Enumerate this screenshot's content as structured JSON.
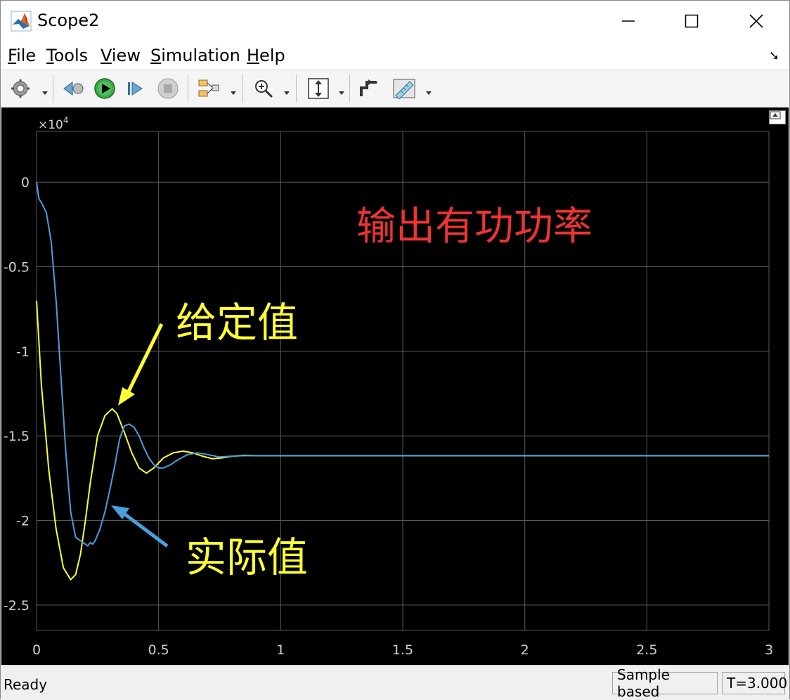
{
  "window": {
    "title": "Scope2"
  },
  "menu": {
    "file_prefix": "",
    "file_ul": "F",
    "file_rest": "ile",
    "tools_ul": "T",
    "tools_rest": "ools",
    "view_ul": "V",
    "view_rest": "iew",
    "simulation_pre": "",
    "simulation_ul": "S",
    "simulation_rest": "imulation",
    "help_ul": "H",
    "help_rest": "elp"
  },
  "toolbar": {
    "icons": [
      "gear-icon",
      "step-back-icon",
      "run-icon",
      "step-forward-icon",
      "stop-icon",
      "signal-selector-icon",
      "zoom-in-icon",
      "scale-axes-icon",
      "cursor-measure-icon",
      "ruler-icon"
    ]
  },
  "status": {
    "ready": "Ready",
    "sample_mode": "Sample based",
    "time": "T=3.000"
  },
  "colors": {
    "plot_bg": "#000000",
    "grid": "#5a5a5a",
    "tick_text": "#d0d0d0",
    "series_given": "#ffff33",
    "series_actual": "#4a9fde",
    "annotation_title": "#ee3333",
    "annotation_label": "#ffff33",
    "arrow_given": "#ffff33",
    "arrow_actual": "#4a9fde"
  },
  "chart_data": {
    "type": "line",
    "title": "",
    "xlabel": "",
    "ylabel": "",
    "y_multiplier": "×10",
    "y_multiplier_exp": "4",
    "xlim": [
      0,
      3
    ],
    "ylim": [
      -2.65,
      0.3
    ],
    "xticks": [
      "0",
      "0.5",
      "1",
      "1.5",
      "2",
      "2.5",
      "3"
    ],
    "xtick_values": [
      0,
      0.5,
      1,
      1.5,
      2,
      2.5,
      3
    ],
    "yticks": [
      "0",
      "-0.5",
      "-1",
      "-1.5",
      "-2",
      "-2.5"
    ],
    "ytick_values": [
      0,
      -0.5,
      -1,
      -1.5,
      -2,
      -2.5
    ],
    "grid": true,
    "series": [
      {
        "key": "given",
        "x": [
          0,
          0.02,
          0.05,
          0.08,
          0.11,
          0.14,
          0.16,
          0.18,
          0.2,
          0.22,
          0.25,
          0.28,
          0.31,
          0.33,
          0.36,
          0.39,
          0.42,
          0.45,
          0.48,
          0.52,
          0.56,
          0.6,
          0.64,
          0.68,
          0.72,
          0.76,
          0.8,
          0.85,
          0.9,
          1,
          1.5,
          2,
          2.5,
          3
        ],
        "y": [
          -0.7,
          -1.2,
          -1.7,
          -2.05,
          -2.28,
          -2.35,
          -2.32,
          -2.2,
          -2.0,
          -1.78,
          -1.5,
          -1.38,
          -1.34,
          -1.37,
          -1.48,
          -1.6,
          -1.69,
          -1.72,
          -1.69,
          -1.63,
          -1.6,
          -1.59,
          -1.6,
          -1.62,
          -1.635,
          -1.63,
          -1.62,
          -1.615,
          -1.617,
          -1.617,
          -1.617,
          -1.617,
          -1.617,
          -1.617
        ]
      },
      {
        "key": "actual",
        "x": [
          0,
          0.005,
          0.01,
          0.02,
          0.04,
          0.06,
          0.08,
          0.1,
          0.12,
          0.14,
          0.16,
          0.18,
          0.2,
          0.21,
          0.22,
          0.23,
          0.24,
          0.26,
          0.28,
          0.3,
          0.32,
          0.34,
          0.36,
          0.38,
          0.4,
          0.42,
          0.44,
          0.46,
          0.48,
          0.5,
          0.52,
          0.55,
          0.58,
          0.62,
          0.66,
          0.7,
          0.75,
          0.8,
          0.85,
          0.9,
          1,
          1.5,
          2,
          2.5,
          3
        ],
        "y": [
          0,
          -0.05,
          -0.1,
          -0.12,
          -0.18,
          -0.35,
          -0.7,
          -1.15,
          -1.6,
          -1.95,
          -2.1,
          -2.12,
          -2.14,
          -2.15,
          -2.13,
          -2.14,
          -2.12,
          -2.05,
          -1.95,
          -1.82,
          -1.68,
          -1.52,
          -1.44,
          -1.43,
          -1.45,
          -1.5,
          -1.57,
          -1.63,
          -1.67,
          -1.69,
          -1.69,
          -1.67,
          -1.64,
          -1.61,
          -1.6,
          -1.61,
          -1.625,
          -1.62,
          -1.617,
          -1.617,
          -1.617,
          -1.617,
          -1.617,
          -1.617,
          -1.617
        ]
      }
    ],
    "annotations": {
      "title_text": "输出有功功率",
      "given_label": "给定值",
      "actual_label": "实际值"
    }
  }
}
